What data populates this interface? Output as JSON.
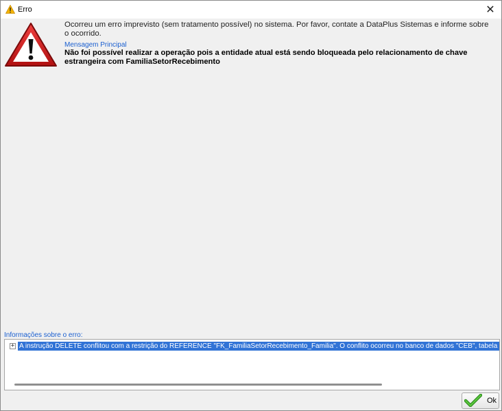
{
  "window": {
    "title": "Erro",
    "close_glyph": "✕"
  },
  "main": {
    "message": "Ocorreu um erro imprevisto (sem tratamento possível) no sistema. Por favor, contate a DataPlus Sistemas e informe sobre o ocorrido.",
    "section_label": "Mensagem Principal",
    "detail": "Não foi possível realizar a operação pois a entidade atual está sendo bloqueada pelo relacionamento de chave estrangeira com FamiliaSetorRecebimento"
  },
  "error_info": {
    "label": "Informações sobre o erro:",
    "items": [
      {
        "expander": "+",
        "text": "A instrução DELETE conflitou com a restrição do REFERENCE \"FK_FamiliaSetorRecebimento_Familia\". O conflito ocorreu no banco de dados \"CEB\", tabela \"dbo.FamiliaSetorRecebimento\""
      }
    ]
  },
  "buttons": {
    "ok_label": "Ok"
  },
  "icons": {
    "title": "warning-icon",
    "main": "warning-large-icon",
    "ok": "checkmark-icon"
  },
  "colors": {
    "accent_link": "#1a5fd0",
    "selection": "#3173d6",
    "warning_red": "#d21f1f",
    "check_green": "#3aa626"
  }
}
